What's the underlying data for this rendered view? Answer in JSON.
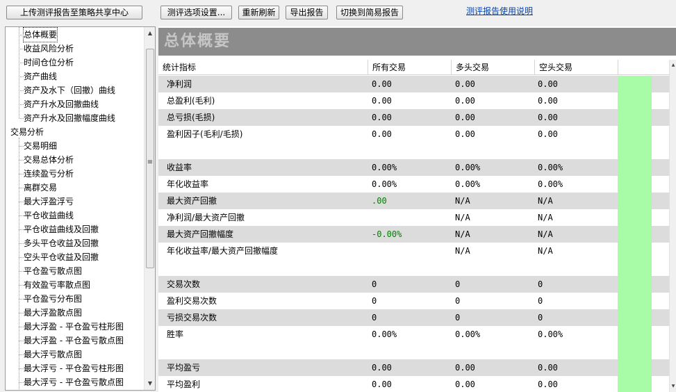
{
  "toolbar": {
    "upload_label": "上传测评报告至策略共享中心",
    "options_label": "测评选项设置...",
    "refresh_label": "重新刷新",
    "export_label": "导出报告",
    "switch_label": "切换到简易报告",
    "help_link": "测评报告使用说明"
  },
  "tree": {
    "items": [
      {
        "label": "总体概要",
        "level": 1,
        "selected": true
      },
      {
        "label": "收益风险分析",
        "level": 1
      },
      {
        "label": "时间仓位分析",
        "level": 1
      },
      {
        "label": "资产曲线",
        "level": 1
      },
      {
        "label": "资产及水下（回撤）曲线",
        "level": 1
      },
      {
        "label": "资产升水及回撤曲线",
        "level": 1
      },
      {
        "label": "资产升水及回撤幅度曲线",
        "level": 1
      },
      {
        "label": "交易分析",
        "level": 0
      },
      {
        "label": "交易明细",
        "level": 1
      },
      {
        "label": "交易总体分析",
        "level": 1
      },
      {
        "label": "连续盈亏分析",
        "level": 1
      },
      {
        "label": "离群交易",
        "level": 1
      },
      {
        "label": "最大浮盈浮亏",
        "level": 1
      },
      {
        "label": "平仓收益曲线",
        "level": 1
      },
      {
        "label": "平仓收益曲线及回撤",
        "level": 1
      },
      {
        "label": "多头平仓收益及回撤",
        "level": 1
      },
      {
        "label": "空头平仓收益及回撤",
        "level": 1
      },
      {
        "label": "平仓盈亏散点图",
        "level": 1
      },
      {
        "label": "有效盈亏率散点图",
        "level": 1
      },
      {
        "label": "平仓盈亏分布图",
        "level": 1
      },
      {
        "label": "最大浮盈散点图",
        "level": 1
      },
      {
        "label": "最大浮盈 - 平仓盈亏柱形图",
        "level": 1
      },
      {
        "label": "最大浮盈 - 平仓盈亏散点图",
        "level": 1
      },
      {
        "label": "最大浮亏散点图",
        "level": 1
      },
      {
        "label": "最大浮亏 - 平仓盈亏柱形图",
        "level": 1
      },
      {
        "label": "最大浮亏 - 平仓盈亏散点图",
        "level": 1
      }
    ]
  },
  "content": {
    "title": "总体概要",
    "columns": [
      "统计指标",
      "所有交易",
      "多头交易",
      "空头交易"
    ],
    "rows": [
      {
        "label": "净利润",
        "all": "0.00",
        "long": "0.00",
        "short": "0.00",
        "tall": false,
        "shade": true
      },
      {
        "label": "总盈利(毛利)",
        "all": "0.00",
        "long": "0.00",
        "short": "0.00",
        "tall": false,
        "shade": false
      },
      {
        "label": "总亏损(毛损)",
        "all": "0.00",
        "long": "0.00",
        "short": "0.00",
        "tall": false,
        "shade": true
      },
      {
        "label": "盈利因子(毛利/毛损)",
        "all": "0.00",
        "long": "0.00",
        "short": "0.00",
        "tall": true,
        "shade": false
      },
      {
        "label": "收益率",
        "all": "0.00%",
        "long": "0.00%",
        "short": "0.00%",
        "tall": false,
        "shade": true
      },
      {
        "label": "年化收益率",
        "all": "0.00%",
        "long": "0.00%",
        "short": "0.00%",
        "tall": false,
        "shade": false
      },
      {
        "label": "最大资产回撤",
        "all": ".00",
        "long": "N/A",
        "short": "N/A",
        "tall": false,
        "shade": true,
        "green": true
      },
      {
        "label": "净利润/最大资产回撤",
        "all": "",
        "long": "N/A",
        "short": "N/A",
        "tall": false,
        "shade": false
      },
      {
        "label": "最大资产回撤幅度",
        "all": "-0.00%",
        "long": "N/A",
        "short": "N/A",
        "tall": false,
        "shade": true,
        "green": true
      },
      {
        "label": "年化收益率/最大资产回撤幅度",
        "all": "",
        "long": "N/A",
        "short": "N/A",
        "tall": true,
        "shade": false
      },
      {
        "label": "交易次数",
        "all": "0",
        "long": "0",
        "short": "0",
        "tall": false,
        "shade": true
      },
      {
        "label": "盈利交易次数",
        "all": "0",
        "long": "0",
        "short": "0",
        "tall": false,
        "shade": false
      },
      {
        "label": "亏损交易次数",
        "all": "0",
        "long": "0",
        "short": "0",
        "tall": false,
        "shade": true
      },
      {
        "label": "胜率",
        "all": "0.00%",
        "long": "0.00%",
        "short": "0.00%",
        "tall": true,
        "shade": false
      },
      {
        "label": "平均盈亏",
        "all": "0.00",
        "long": "0.00",
        "short": "0.00",
        "tall": false,
        "shade": true
      },
      {
        "label": "平均盈利",
        "all": "0.00",
        "long": "0.00",
        "short": "0.00",
        "tall": false,
        "shade": false
      }
    ]
  },
  "colors": {
    "banner": "#8c8c8c",
    "banner_text": "#c6c6c6",
    "row_shade": "#dcdcdc",
    "green_column": "#a8fca8",
    "green_value": "#008000",
    "link": "#0645ad"
  },
  "icons": [
    "scroll-up-arrow-icon",
    "scroll-down-arrow-icon",
    "scroll-grip-icon"
  ]
}
